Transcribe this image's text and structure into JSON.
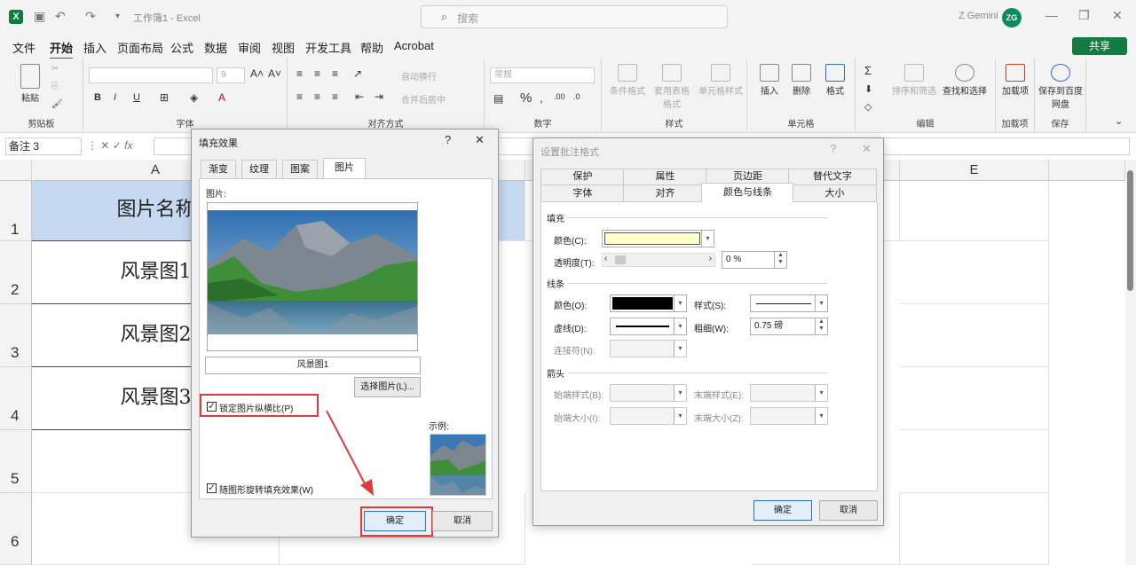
{
  "titlebar": {
    "doc_title": "工作簿1 - Excel",
    "search_placeholder": "搜索",
    "user_name": "Z Gemini",
    "avatar_initials": "ZG"
  },
  "menu": {
    "items": [
      "文件",
      "开始",
      "插入",
      "页面布局",
      "公式",
      "数据",
      "审阅",
      "视图",
      "开发工具",
      "帮助",
      "Acrobat"
    ],
    "active": "开始",
    "share_label": "共享"
  },
  "ribbon": {
    "clipboard": {
      "label": "剪贴板",
      "paste": "粘贴"
    },
    "font": {
      "label": "字体",
      "size": "9"
    },
    "alignment": {
      "label": "对齐方式",
      "wrap": "自动换行",
      "merge": "合并后居中"
    },
    "number": {
      "label": "数字",
      "format": "常规"
    },
    "styles": {
      "label": "样式",
      "conditional": "条件格式",
      "table": "套用表格格式",
      "cell_styles": "单元格样式"
    },
    "cells": {
      "label": "单元格",
      "insert": "插入",
      "delete": "删除",
      "format": "格式"
    },
    "editing": {
      "label": "编辑",
      "sort": "排序和筛选",
      "find": "查找和选择"
    },
    "addins": {
      "label": "加载项",
      "btn": "加载项"
    },
    "save": {
      "label": "保存",
      "btn": "保存到百度网盘"
    }
  },
  "formula_bar": {
    "name_box": "备注 3",
    "fx": "fx"
  },
  "sheet": {
    "columns": [
      "A",
      "E"
    ],
    "rows": [
      "1",
      "2",
      "3",
      "4",
      "5",
      "6"
    ],
    "cells_a": [
      "图片名称",
      "风景图1",
      "风景图2",
      "风景图3"
    ],
    "header_fill": "#c5d9f1"
  },
  "fill_dialog": {
    "title": "填充效果",
    "help": "?",
    "close": "✕",
    "tabs": [
      "渐变",
      "纹理",
      "图案",
      "图片"
    ],
    "active_tab": "图片",
    "picture_label": "图片:",
    "picture_name": "风景图1",
    "select_button": "选择图片(L)...",
    "lock_aspect": "锁定图片纵横比(P)",
    "rotate_with_shape": "随图形旋转填充效果(W)",
    "sample_label": "示例:",
    "ok": "确定",
    "cancel": "取消",
    "highlight_color": "#e03a3a"
  },
  "comment_dialog": {
    "title": "设置批注格式",
    "help": "?",
    "close": "✕",
    "tabs_row1": [
      "保护",
      "属性",
      "页边距",
      "替代文字"
    ],
    "tabs_row2": [
      "字体",
      "对齐",
      "颜色与线条",
      "大小"
    ],
    "active_tab": "颜色与线条",
    "fill_section": "填充",
    "fill_color_label": "颜色(C):",
    "fill_color": "#ffffcc",
    "transparency_label": "透明度(T):",
    "transparency_value": "0 %",
    "line_section": "线条",
    "line_color_label": "颜色(O):",
    "line_color": "#000000",
    "line_style_label": "样式(S):",
    "dash_label": "虚线(D):",
    "weight_label": "粗细(W):",
    "weight_value": "0.75 磅",
    "connector_label": "连接符(N):",
    "arrow_section": "箭头",
    "begin_style": "始端样式(B):",
    "end_style": "末端样式(E):",
    "begin_size": "始端大小(I):",
    "end_size": "末端大小(Z):",
    "ok": "确定",
    "cancel": "取消"
  }
}
